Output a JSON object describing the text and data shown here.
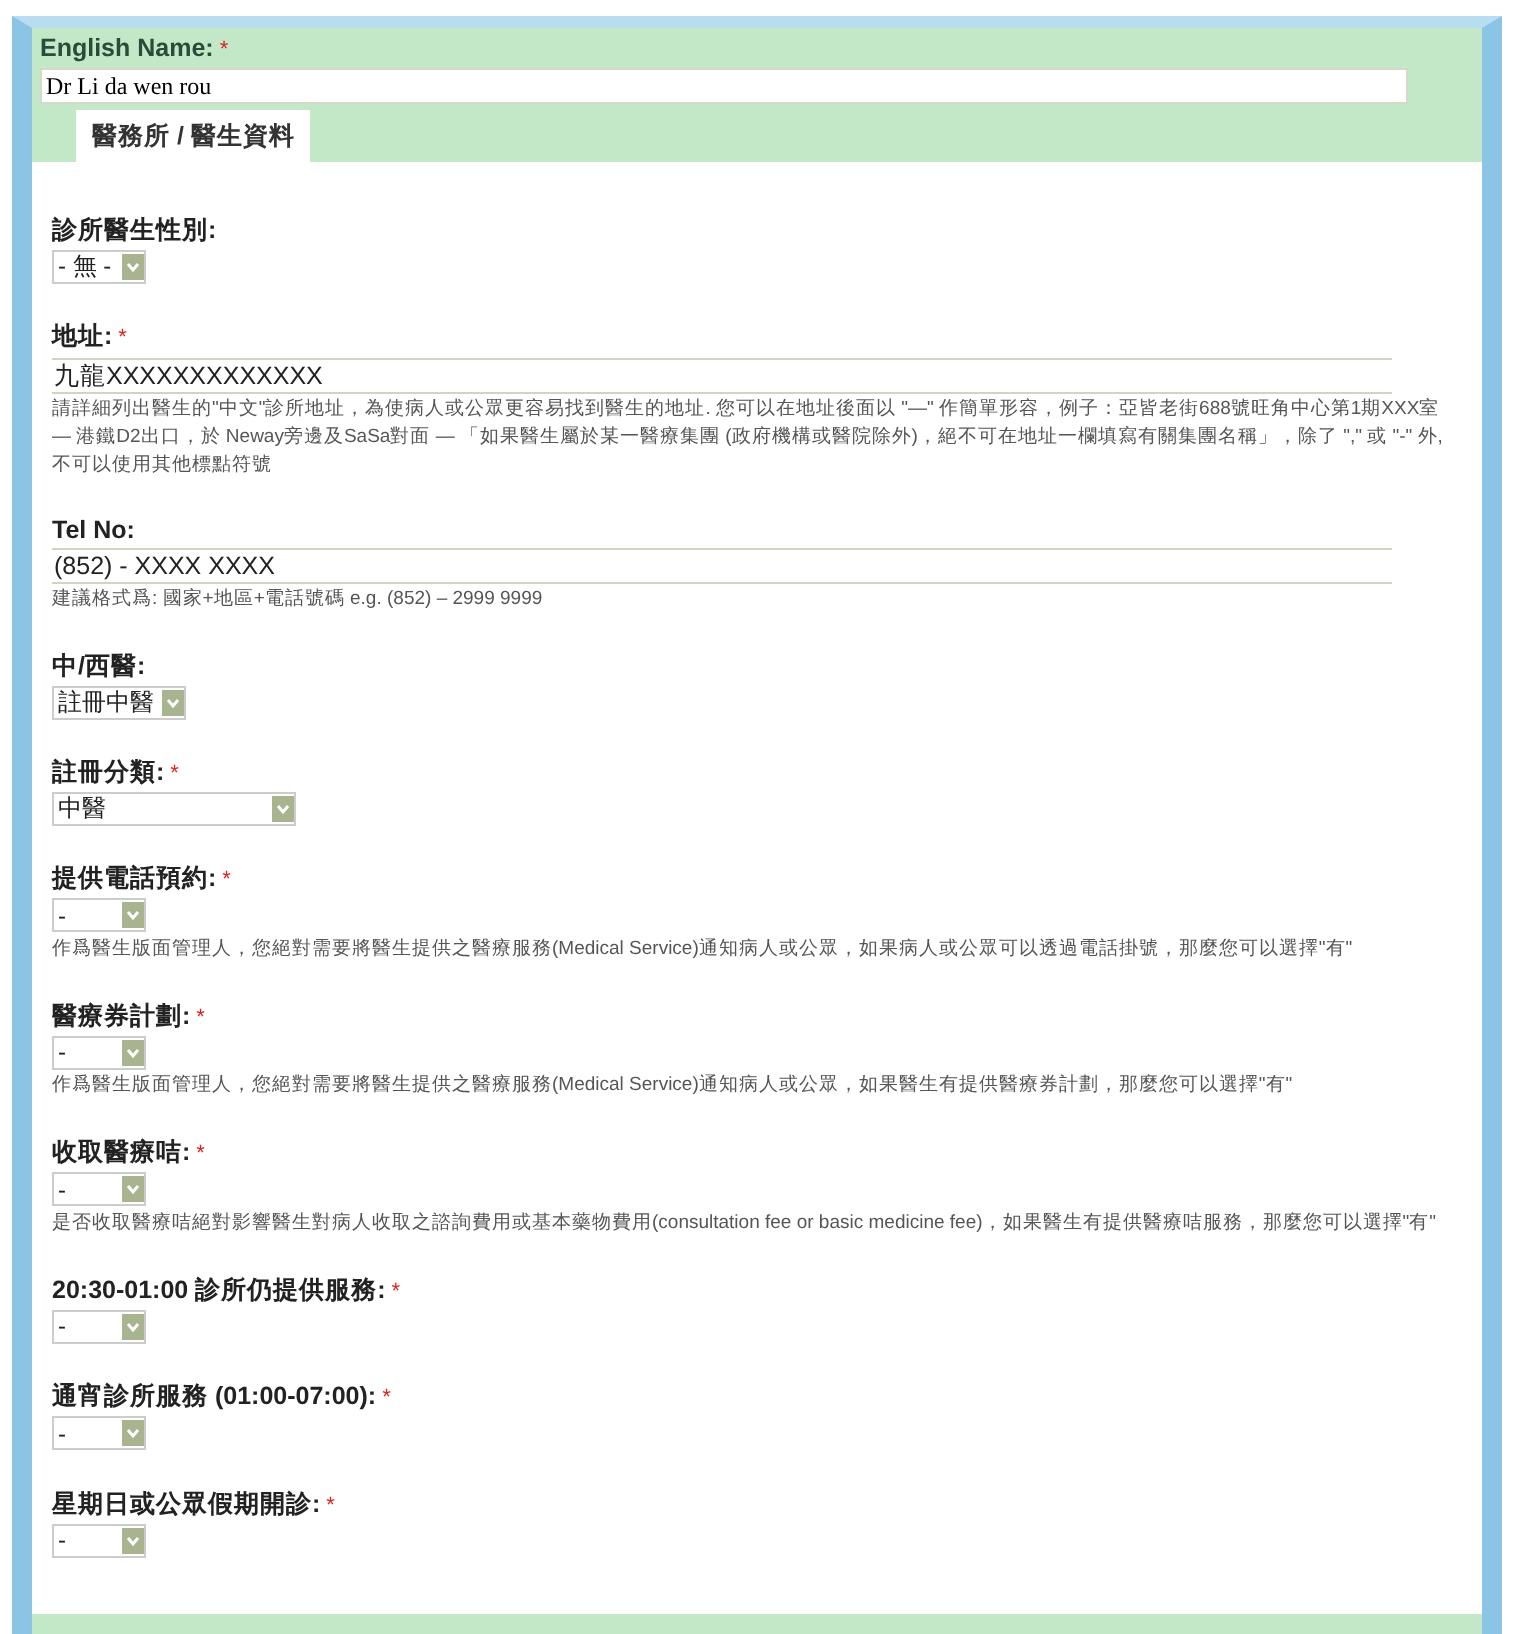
{
  "header": {
    "label": "English Name:",
    "required_mark": "*",
    "value": "Dr Li da wen rou"
  },
  "tab": {
    "label": "醫務所 / 醫生資料",
    "selected": true
  },
  "fields": [
    {
      "kind": "select",
      "label": "診所醫生性別:",
      "value": "- 無 -"
    },
    {
      "kind": "text",
      "label": "地址:",
      "required_mark": "*",
      "value": "九龍XXXXXXXXXXXXX",
      "hint": "請詳細列出醫生的\"中文\"診所地址，為使病人或公眾更容易找到醫生的地址. 您可以在地址後面以 \"—\" 作簡單形容，例子：亞皆老街688號旺角中心第1期XXX室 — 港鐵D2出口，於 Neway旁邊及SaSa對面 — 「如果醫生屬於某一醫療集團 (政府機構或醫院除外)，絕不可在地址一欄填寫有關集團名稱」，除了 \",\" 或 \"-\" 外, 不可以使用其他標點符號"
    },
    {
      "kind": "text",
      "label": "Tel No:",
      "value": "(852) - XXXX XXXX",
      "hint": "建議格式爲: 國家+地區+電話號碼  e.g. (852) – 2999 9999"
    },
    {
      "kind": "select",
      "label": "中/西醫:",
      "value": "註冊中醫"
    },
    {
      "kind": "select",
      "label": "註冊分類:",
      "required_mark": "*",
      "value": "中醫",
      "wide": true
    },
    {
      "kind": "select",
      "label": "提供電話預約:",
      "required_mark": "*",
      "value": "-",
      "hint": "作爲醫生版面管理人，您絕對需要將醫生提供之醫療服務(Medical Service)通知病人或公眾，如果病人或公眾可以透過電話掛號，那麼您可以選擇\"有\""
    },
    {
      "kind": "select",
      "label": "醫療券計劃:",
      "required_mark": "*",
      "value": "-",
      "hint": "作爲醫生版面管理人，您絕對需要將醫生提供之醫療服務(Medical Service)通知病人或公眾，如果醫生有提供醫療券計劃，那麼您可以選擇\"有\""
    },
    {
      "kind": "select",
      "label": "收取醫療咭:",
      "required_mark": "*",
      "value": "-",
      "hint": "是否收取醫療咭絕對影響醫生對病人收取之諮詢費用或基本藥物費用(consultation fee or basic medicine fee)，如果醫生有提供醫療咭服務，那麼您可以選擇\"有\""
    },
    {
      "kind": "select",
      "label": "20:30-01:00 診所仍提供服務:",
      "required_mark": "*",
      "value": "-"
    },
    {
      "kind": "select",
      "label": "通宵診所服務 (01:00-07:00):",
      "required_mark": "*",
      "value": "-"
    },
    {
      "kind": "select",
      "label": "星期日或公眾假期開診:",
      "required_mark": "*",
      "value": "-"
    }
  ]
}
